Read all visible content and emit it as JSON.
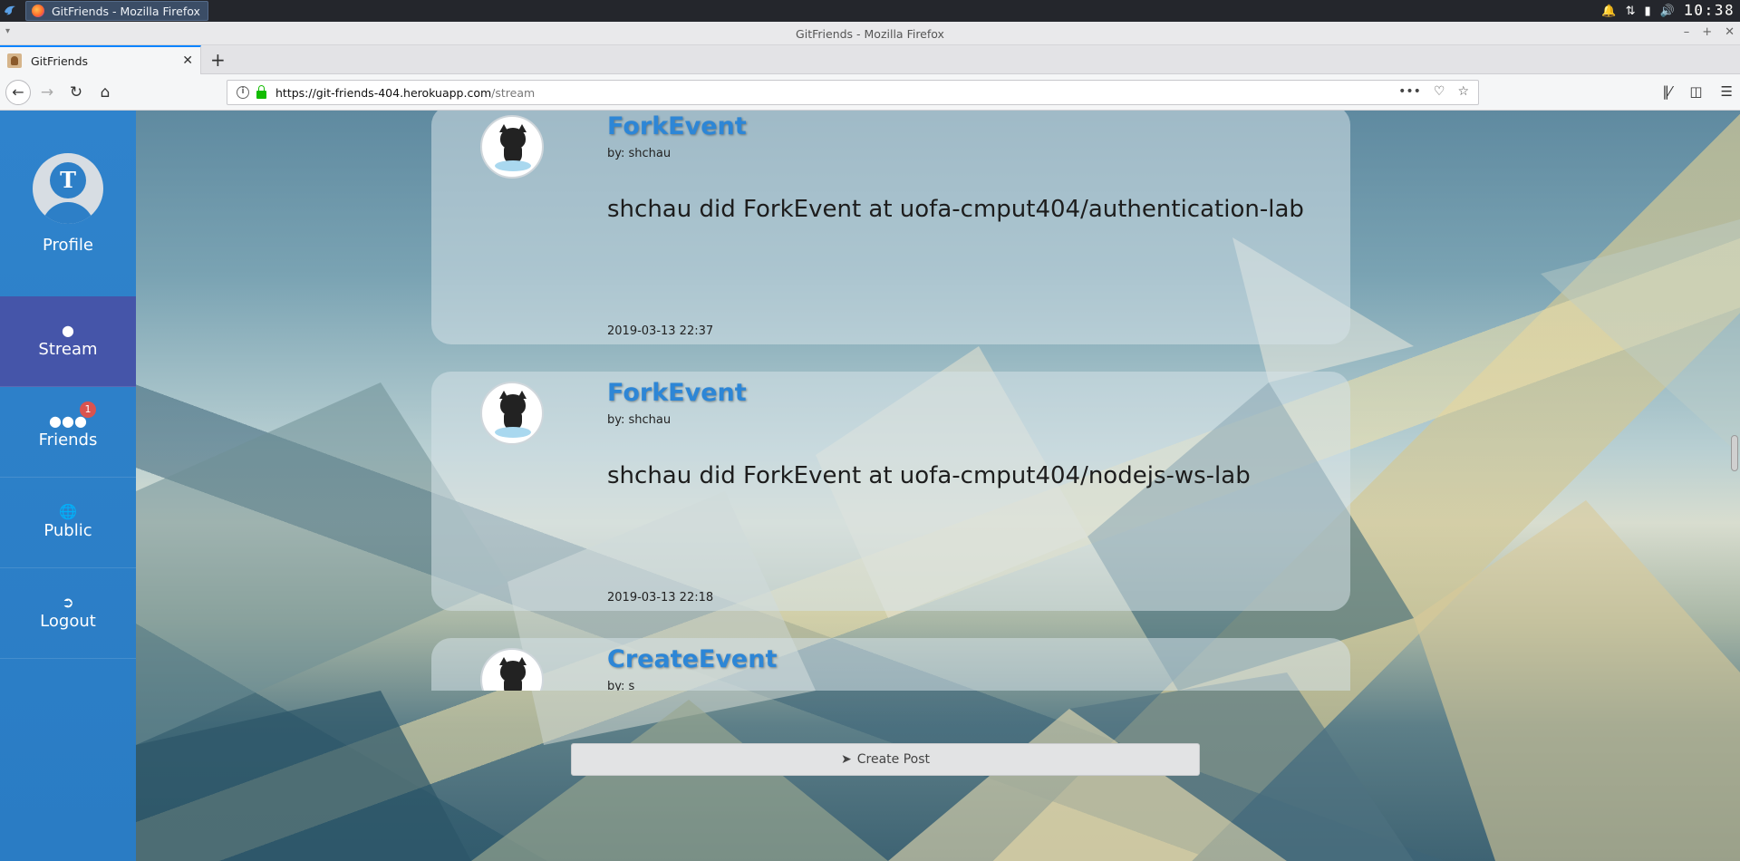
{
  "os": {
    "task_title": "GitFriends - Mozilla Firefox",
    "clock": "10:38"
  },
  "browser": {
    "window_title": "GitFriends - Mozilla Firefox",
    "tab_title": "GitFriends",
    "url_host": "https://git-friends-404.herokuapp.com",
    "url_path": "/stream"
  },
  "sidebar": {
    "profile_initial": "T",
    "profile_label": "Profile",
    "items": [
      {
        "label": "Stream",
        "icon": "droplet-icon",
        "active": true
      },
      {
        "label": "Friends",
        "icon": "users-icon",
        "badge": "1"
      },
      {
        "label": "Public",
        "icon": "globe-icon"
      },
      {
        "label": "Logout",
        "icon": "sign-out-icon"
      }
    ]
  },
  "posts": [
    {
      "title": "ForkEvent",
      "by": "by: shchau",
      "body": "shchau did ForkEvent at uofa-cmput404/authentication-lab",
      "date": "2019-03-13 22:37"
    },
    {
      "title": "ForkEvent",
      "by": "by: shchau",
      "body": "shchau did ForkEvent at uofa-cmput404/nodejs-ws-lab",
      "date": "2019-03-13 22:18"
    },
    {
      "title": "CreateEvent",
      "by": "by: s",
      "body": "",
      "date": ""
    }
  ],
  "create_post_label": "Create Post",
  "colors": {
    "sidebar": "#2f83cc",
    "sidebar_active": "#4555a9",
    "post_title": "#2d86d6",
    "badge": "#d9534f"
  }
}
